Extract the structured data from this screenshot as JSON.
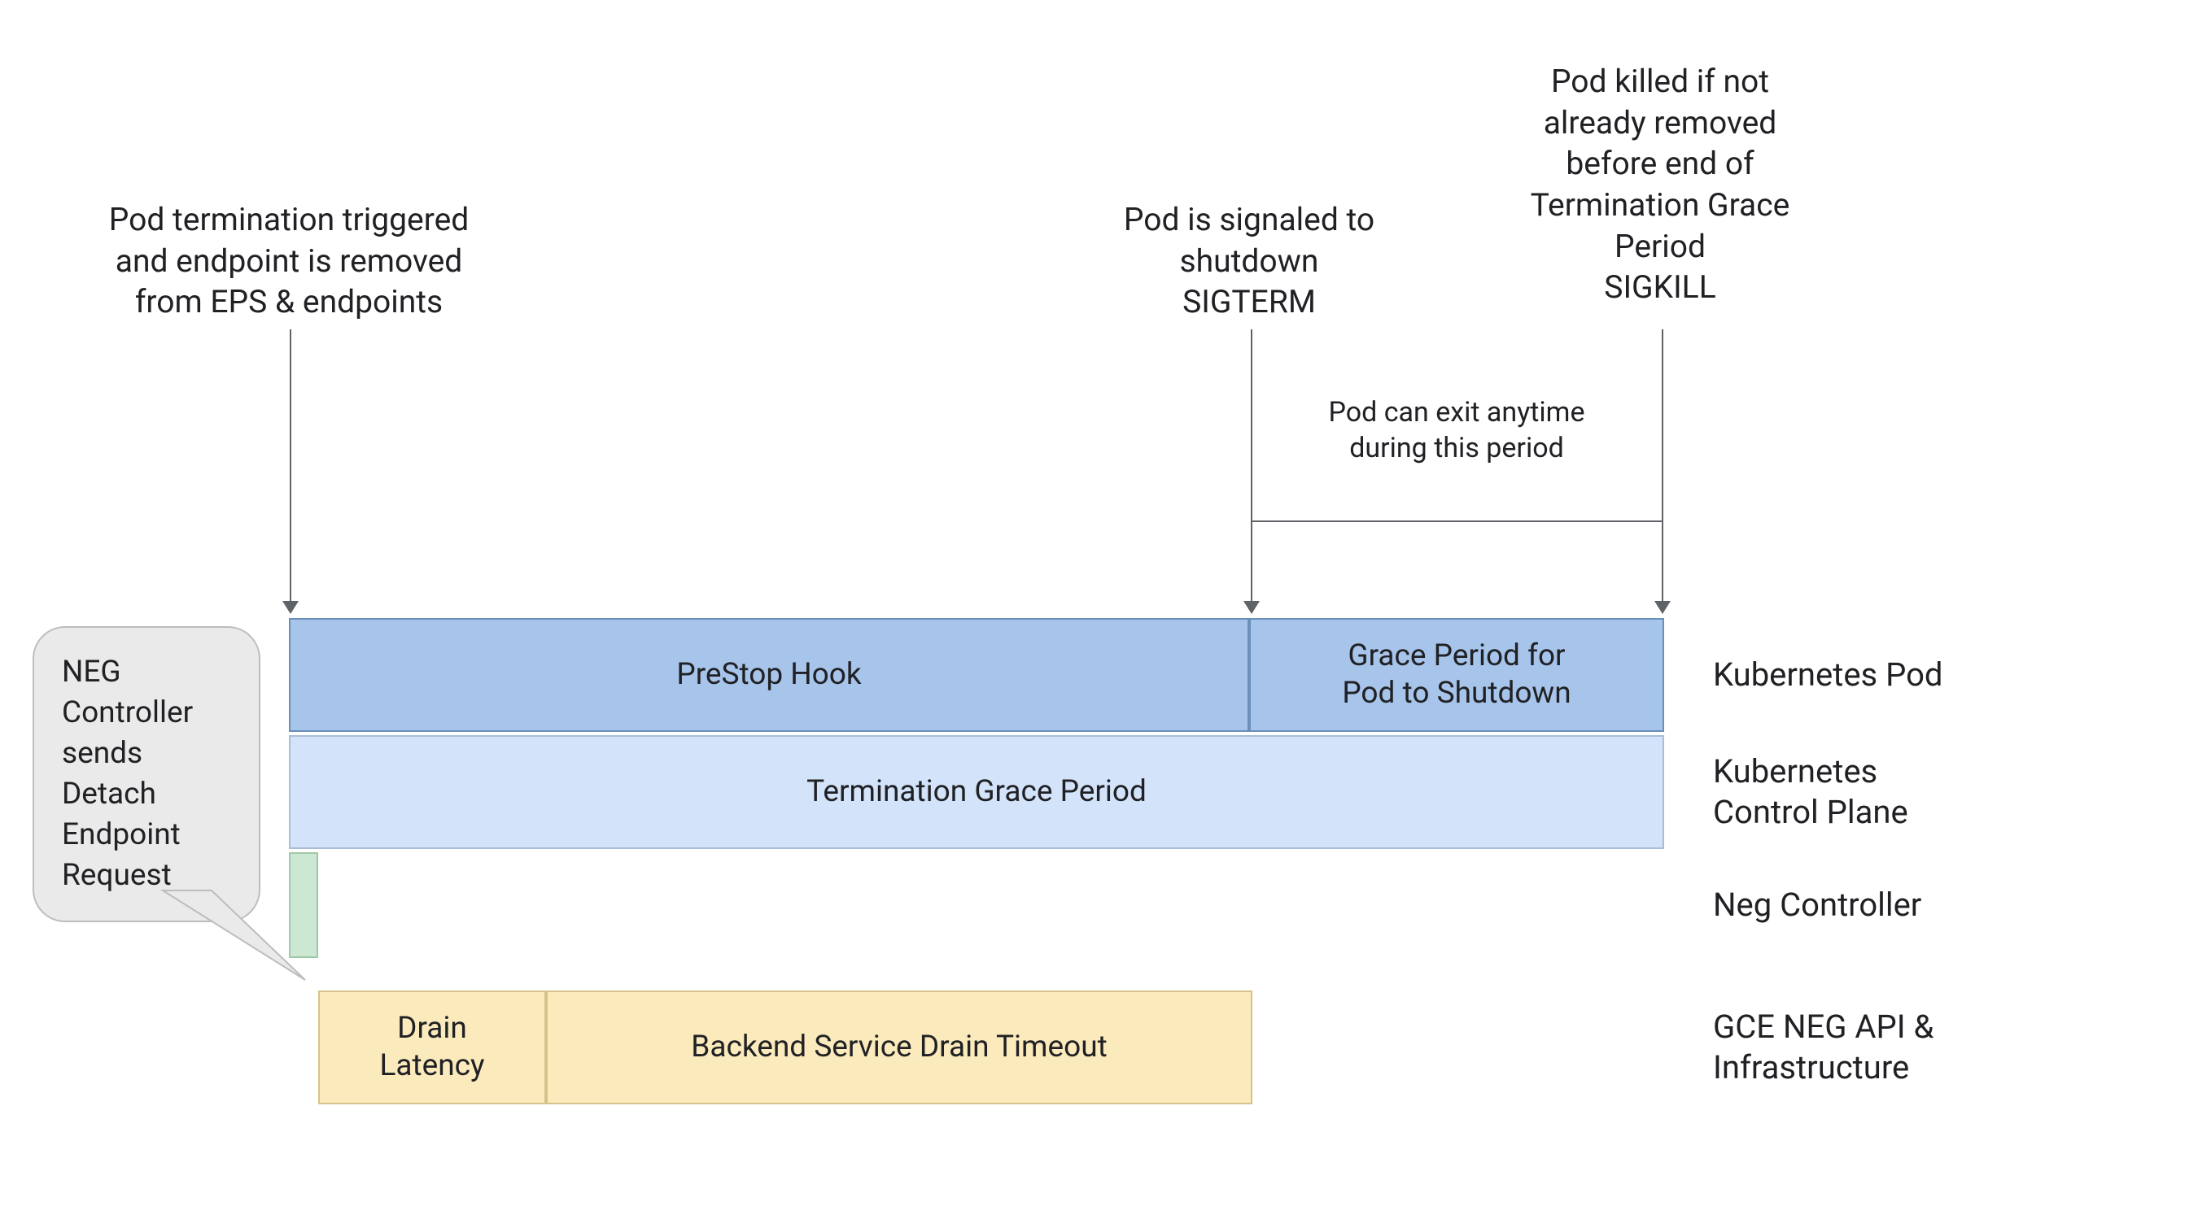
{
  "annotations": {
    "pod_termination_triggered": "Pod termination triggered\nand endpoint is removed\nfrom EPS & endpoints",
    "pod_signaled": "Pod is signaled to\nshutdown\nSIGTERM",
    "pod_killed": "Pod killed if not\nalready removed\nbefore end of\nTermination Grace\nPeriod\nSIGKILL",
    "pod_exit_anytime": "Pod can exit anytime\nduring this period"
  },
  "callout": {
    "neg_controller_sends": "NEG\nController\nsends\nDetach\nEndpoint\nRequest"
  },
  "lanes": {
    "kubernetes_pod": "Kubernetes Pod",
    "kubernetes_control_plane": "Kubernetes\nControl Plane",
    "neg_controller": "Neg Controller",
    "gce_neg_api": "GCE NEG API &\nInfrastructure"
  },
  "blocks": {
    "prestop_hook": "PreStop Hook",
    "grace_period_shutdown": "Grace Period for\nPod to Shutdown",
    "termination_grace_period": "Termination Grace Period",
    "drain_latency": "Drain\nLatency",
    "backend_service_drain_timeout": "Backend Service Drain Timeout"
  }
}
